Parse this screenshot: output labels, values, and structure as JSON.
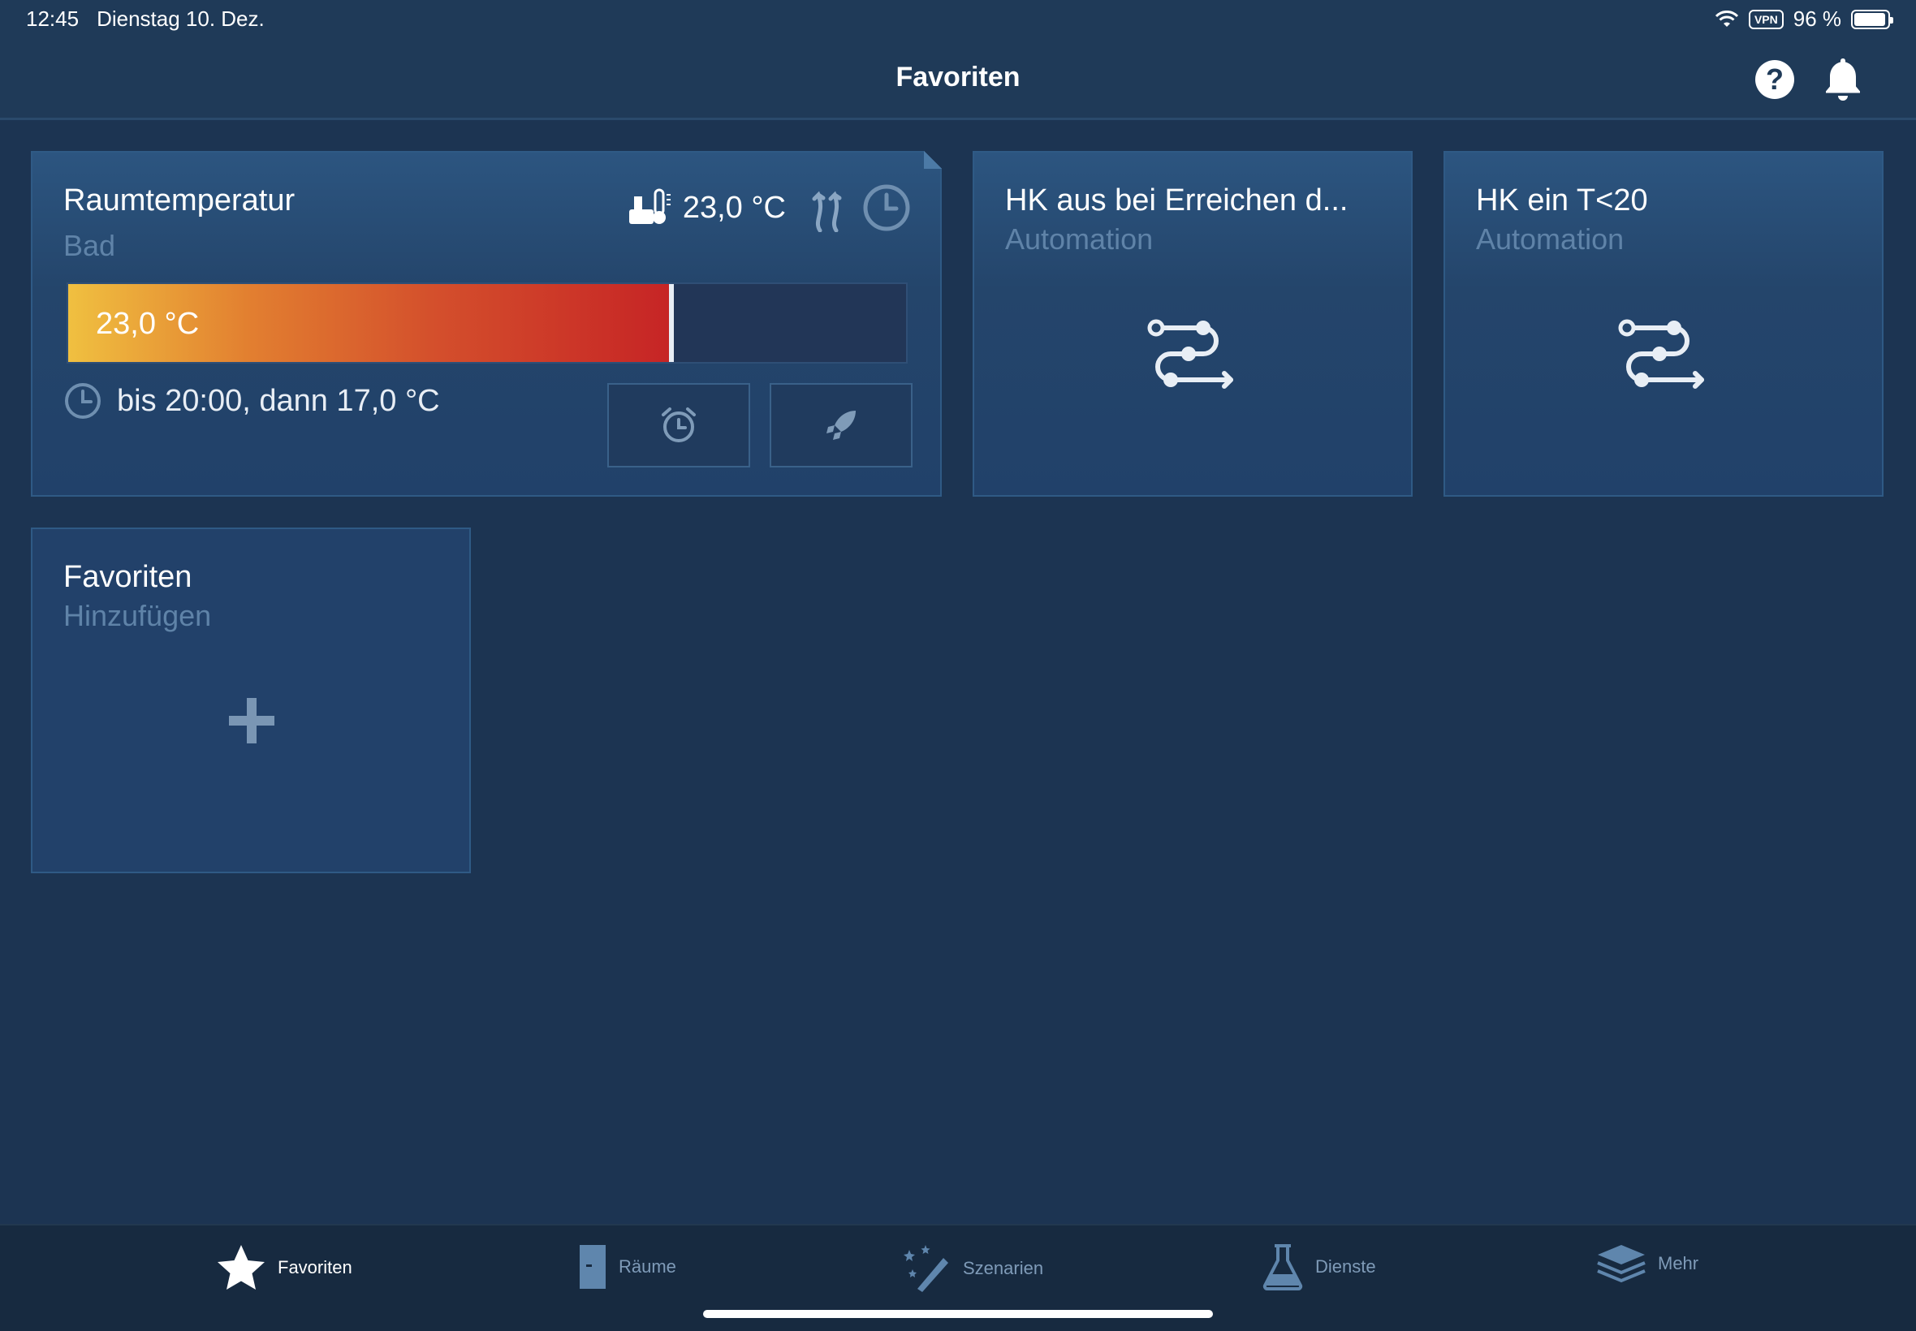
{
  "status_bar": {
    "time": "12:45",
    "date": "Dienstag 10. Dez.",
    "vpn": "VPN",
    "battery": "96 %",
    "battery_level": 0.96,
    "icons": [
      "wifi-icon",
      "battery-icon"
    ]
  },
  "header": {
    "title": "Favoriten",
    "help_label": "?",
    "icons": [
      "help-icon",
      "bell-icon"
    ]
  },
  "room_card": {
    "title": "Raumtemperatur",
    "subtitle": "Bad",
    "current_temp": "23,0 °C",
    "bar_label": "23,0 °C",
    "bar_fill": 0.72,
    "schedule_text": "bis 20:00, dann 17,0 °C",
    "icons": [
      "thermostat-icon",
      "heating-icon",
      "clock-icon",
      "alarm-clock-icon",
      "rocket-icon"
    ]
  },
  "automations": [
    {
      "title": "HK aus bei Erreichen d...",
      "subtitle": "Automation",
      "icon": "automation-icon"
    },
    {
      "title": "HK ein T<20",
      "subtitle": "Automation",
      "icon": "automation-icon"
    }
  ],
  "add_card": {
    "title": "Favoriten",
    "subtitle": "Hinzufügen",
    "icon": "plus-icon"
  },
  "tabbar": {
    "active": "Favoriten",
    "tabs": [
      {
        "label": "Favoriten",
        "icon": "star-icon"
      },
      {
        "label": "Räume",
        "icon": "door-icon"
      },
      {
        "label": "Szenarien",
        "icon": "magic-wand-icon"
      },
      {
        "label": "Dienste",
        "icon": "flask-icon"
      },
      {
        "label": "Mehr",
        "icon": "layers-icon"
      }
    ]
  },
  "colors": {
    "background": "#1c3452",
    "card": "#24456b",
    "accent_warm": "#c62425",
    "accent_yellow": "#f0c040",
    "muted_text": "#5f83a8"
  }
}
